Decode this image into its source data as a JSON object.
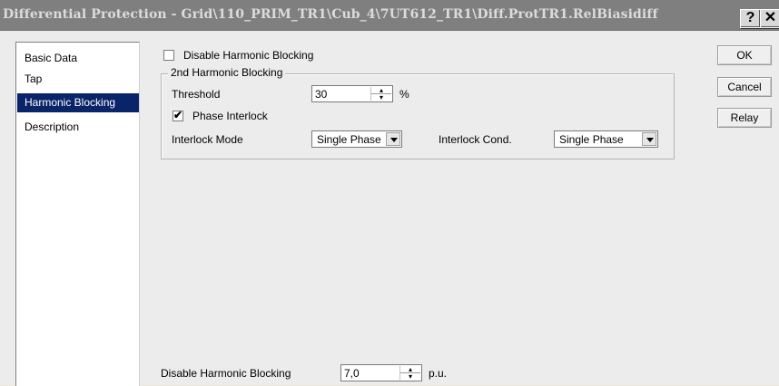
{
  "window": {
    "title": "Differential Protection - Grid\\110_PRIM_TR1\\Cub_4\\7UT612_TR1\\Diff.ProtTR1.RelBiasidiff",
    "help_label": "?",
    "close_label": "✕"
  },
  "nav": {
    "items": [
      {
        "label": "Basic Data",
        "selected": false
      },
      {
        "label": "Tap",
        "selected": false
      },
      {
        "label": "Harmonic Blocking",
        "selected": true
      },
      {
        "label": "Description",
        "selected": false
      }
    ]
  },
  "form": {
    "disable_harmonic_blocking_label": "Disable Harmonic Blocking",
    "disable_harmonic_blocking_checked": false,
    "group_title": "2nd Harmonic Blocking",
    "threshold_label": "Threshold",
    "threshold_value": "30",
    "threshold_unit": "%",
    "phase_interlock_label": "Phase Interlock",
    "phase_interlock_checked": true,
    "interlock_mode_label": "Interlock Mode",
    "interlock_mode_value": "Single Phase",
    "interlock_cond_label": "Interlock Cond.",
    "interlock_cond_value": "Single Phase",
    "bottom_label": "Disable Harmonic Blocking",
    "bottom_value": "7,0",
    "bottom_unit": "p.u."
  },
  "buttons": {
    "ok": "OK",
    "cancel": "Cancel",
    "relay": "Relay"
  }
}
